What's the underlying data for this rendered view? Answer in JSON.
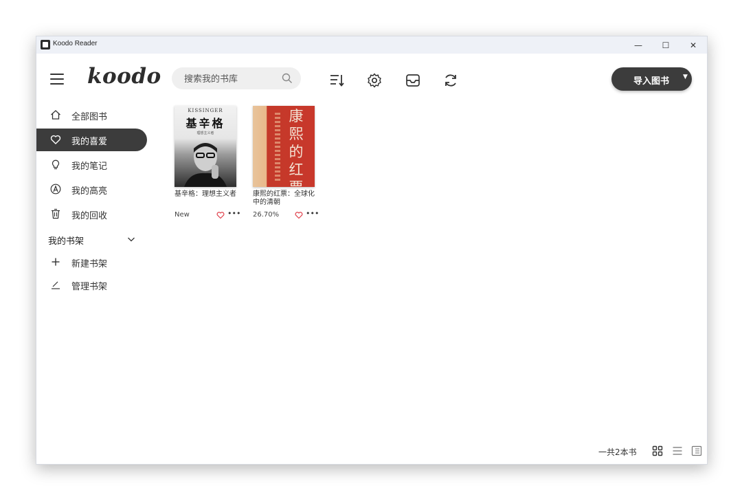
{
  "window": {
    "title": "Koodo Reader",
    "controls": {
      "minimize": "—",
      "maximize": "☐",
      "close": "✕"
    }
  },
  "header": {
    "logo": "koodo",
    "search_placeholder": "搜索我的书库",
    "import_label": "导入图书",
    "import_caret": "▼",
    "toolbar_icons": [
      "sort-icon",
      "settings-icon",
      "inbox-icon",
      "sync-icon"
    ]
  },
  "sidebar": {
    "items": [
      {
        "label": "全部图书",
        "icon": "home-icon",
        "active": false
      },
      {
        "label": "我的喜爱",
        "icon": "heart-icon",
        "active": true
      },
      {
        "label": "我的笔记",
        "icon": "bulb-icon",
        "active": false
      },
      {
        "label": "我的高亮",
        "icon": "highlight-icon",
        "active": false
      },
      {
        "label": "我的回收",
        "icon": "trash-icon",
        "active": false
      }
    ],
    "shelf_header": "我的书架",
    "shelf_items": [
      {
        "label": "新建书架",
        "icon": "plus-icon"
      },
      {
        "label": "管理书架",
        "icon": "edit-icon"
      }
    ]
  },
  "books": [
    {
      "title": "基辛格：理想主义者",
      "status": "New",
      "cover": {
        "top": "KISSINGER",
        "main": "基辛格",
        "sub": "理想主义者"
      }
    },
    {
      "title": "康熙的红票：全球化中的清朝",
      "status": "26.70%",
      "cover": {
        "main": "康熙的红票"
      }
    }
  ],
  "footer": {
    "total": "一共2本书",
    "view_icons": [
      "grid-view-icon",
      "list-view-icon",
      "cover-view-icon"
    ]
  },
  "colors": {
    "active_bg": "#3c3c3c",
    "heart": "#e0424d",
    "titlebar": "#eef1f7",
    "search_bg": "#efefef"
  }
}
